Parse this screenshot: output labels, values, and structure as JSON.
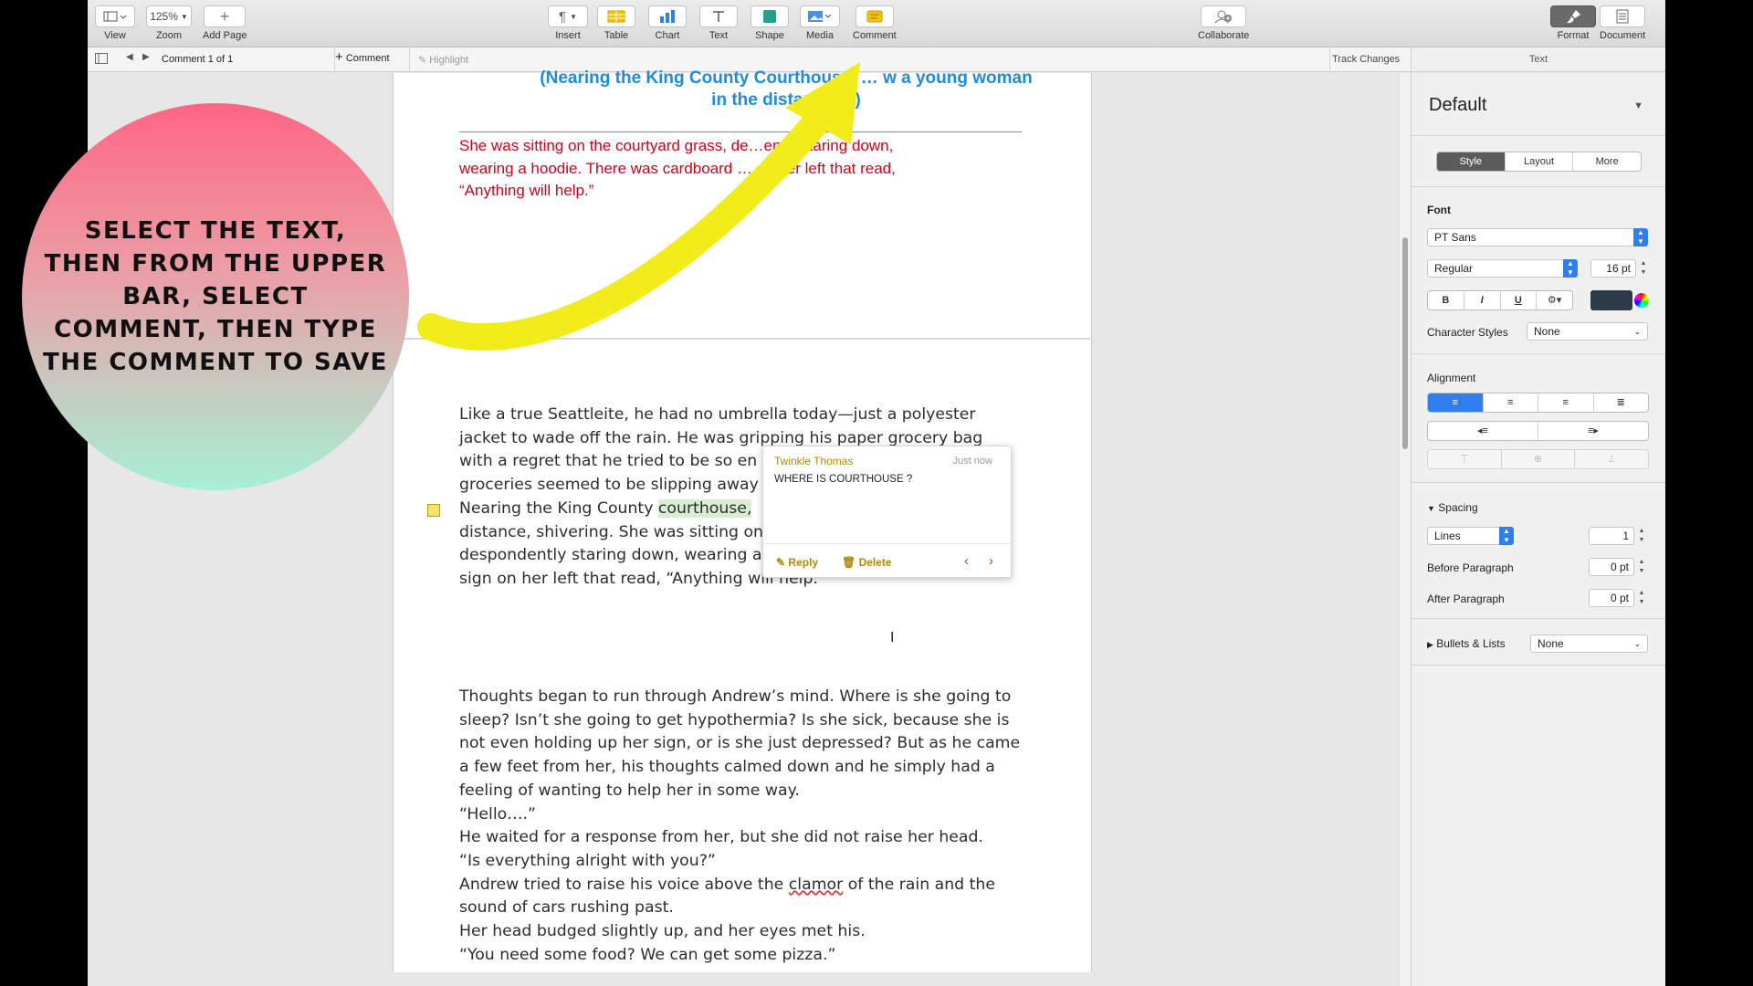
{
  "toolbar": {
    "view": "View",
    "zoom": "Zoom",
    "zoom_value": "125%",
    "add_page": "Add Page",
    "insert": "Insert",
    "table": "Table",
    "chart": "Chart",
    "text": "Text",
    "shape": "Shape",
    "media": "Media",
    "comment": "Comment",
    "collaborate": "Collaborate",
    "format": "Format",
    "document": "Document"
  },
  "subbar": {
    "comment_counter": "Comment 1 of 1",
    "add_comment": "Comment",
    "highlight": "Highlight",
    "track_changes": "Track Changes",
    "inspector_tab": "Text"
  },
  "document": {
    "heading_lines": [
      "(Nearing the King County Courthouse, … w a young woman",
      "in the distance….)"
    ],
    "red_lines": [
      "She was sitting on the courtyard grass, de…ently staring down,",
      "wearing a hoodie. There was cardboard … on her left that read,",
      "“Anything will help.”"
    ],
    "para1": {
      "l1": "Like a true Seattleite, he had no umbrella today—just a polyester",
      "l2": "jacket to wade off the rain. He was gripping his paper grocery bag",
      "l3": "with a regret that he tried to be so en",
      "l4": "groceries seemed to be slipping away",
      "l5_before": "Nearing the King County ",
      "l5_highlight": "courthouse,",
      "l6": "distance, shivering. She was sitting on",
      "l7": "despondently staring down, wearing a",
      "l8": "sign on her left that read, “Anything will help.”"
    },
    "para2": {
      "l1": "Thoughts began to run through Andrew’s mind. Where is she going to",
      "l2": "sleep? Isn’t she going to get hypothermia? Is she sick, because she is",
      "l3": "not even holding up her sign, or is she just depressed? But as he came",
      "l4": "a few feet from her, his thoughts calmed down and he simply had a",
      "l5": "feeling of wanting to help her in some way.",
      "l6": "“Hello….”",
      "l7": "He waited for a response from her, but she did not raise her head.",
      "l8": "“Is everything alright with you?”",
      "l9_before": "Andrew tried to raise his voice above the ",
      "l9_squiggle": "clamor",
      "l9_after": " of the rain and the",
      "l10": "sound of cars rushing past.",
      "l11": "Her head budged slightly up, and her eyes met his.",
      "l12": "“You need some food? We can get some pizza.”"
    }
  },
  "comment": {
    "author": "Twinkle Thomas",
    "time": "Just now",
    "text": "WHERE IS COURTHOUSE ?",
    "reply": "Reply",
    "delete": "Delete"
  },
  "overlay": {
    "instruction": "SELECT THE TEXT, THEN FROM THE UPPER BAR, SELECT COMMENT, THEN TYPE THE COMMENT TO SAVE"
  },
  "inspector": {
    "style_name": "Default",
    "tabs": [
      "Style",
      "Layout",
      "More"
    ],
    "font_label": "Font",
    "font_family": "PT Sans",
    "font_weight": "Regular",
    "font_size": "16 pt",
    "bold": "B",
    "italic": "I",
    "underline": "U",
    "char_styles_label": "Character Styles",
    "char_styles_value": "None",
    "alignment_label": "Alignment",
    "spacing_label": "Spacing",
    "spacing_mode": "Lines",
    "spacing_value": "1",
    "before_para_label": "Before Paragraph",
    "before_para_value": "0 pt",
    "after_para_label": "After Paragraph",
    "after_para_value": "0 pt",
    "bullets_label": "Bullets & Lists",
    "bullets_value": "None",
    "colors": {
      "text_color": "#2c3a4a",
      "accent": "#2f7ef0"
    }
  }
}
